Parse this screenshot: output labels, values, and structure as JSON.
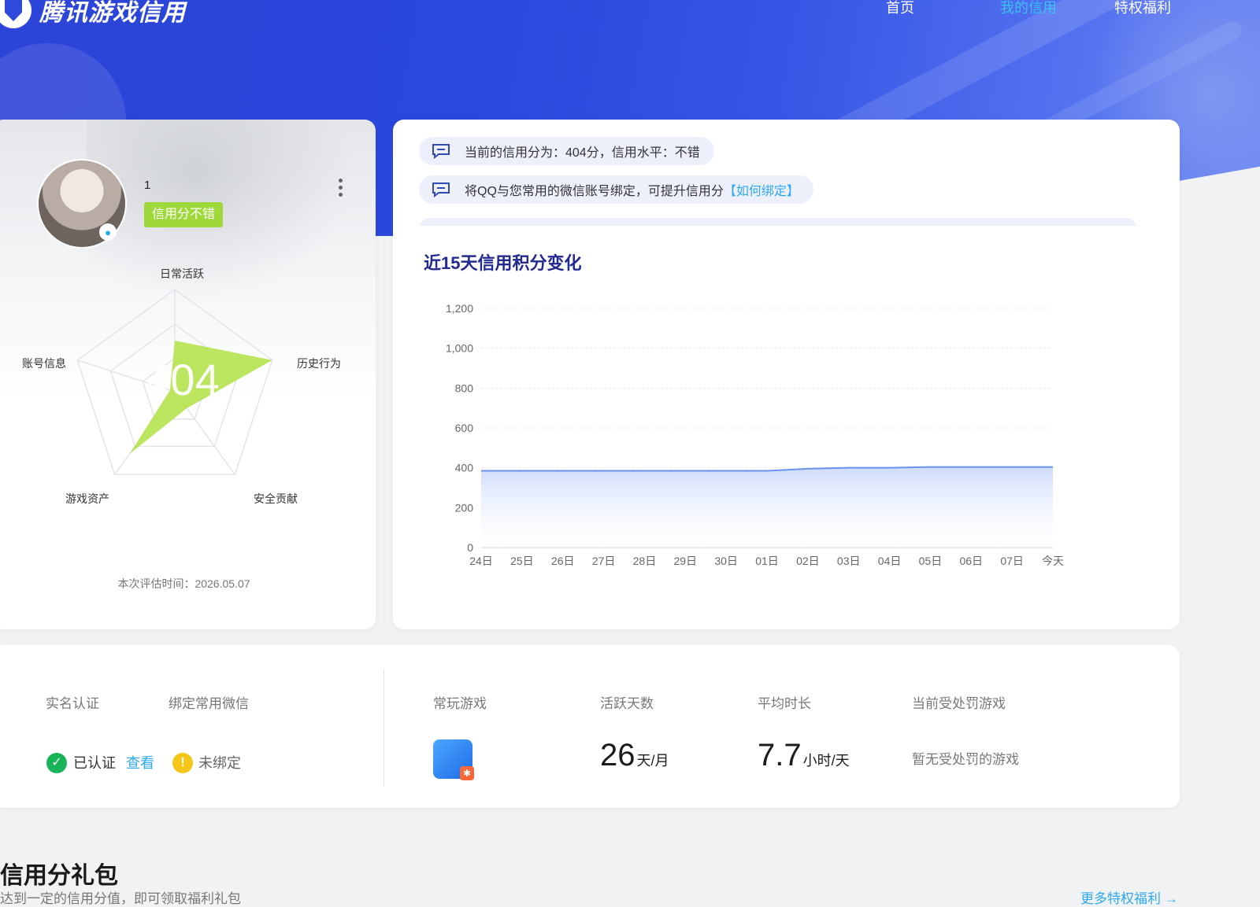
{
  "header": {
    "logo_text": "腾讯游戏信用",
    "nav": [
      "首页",
      "我的信用",
      "特权福利"
    ],
    "nav_active_index": 1
  },
  "profile": {
    "username": "1",
    "level_badge": "信用分不错",
    "score": "404",
    "radar_labels": [
      "日常活跃",
      "历史行为",
      "安全贡献",
      "游戏资产",
      "账号信息"
    ],
    "radar_values": [
      0.5,
      1.0,
      0.2,
      0.75,
      0.05
    ],
    "eval_time": "本次评估时间：2026.05.07"
  },
  "notices": [
    {
      "text": "当前的信用分为：404分，信用水平：不错",
      "link": ""
    },
    {
      "text": "将QQ与您常用的微信账号绑定，可提升信用分",
      "link": "【如何绑定】"
    }
  ],
  "chart": {
    "title": "近15天信用积分变化"
  },
  "chart_data": {
    "type": "area",
    "categories": [
      "24日",
      "25日",
      "26日",
      "27日",
      "28日",
      "29日",
      "30日",
      "01日",
      "02日",
      "03日",
      "04日",
      "05日",
      "06日",
      "07日",
      "今天"
    ],
    "values": [
      385,
      385,
      385,
      385,
      385,
      385,
      385,
      385,
      395,
      400,
      400,
      404,
      404,
      404,
      404
    ],
    "ylim": [
      0,
      1200
    ],
    "yticks": [
      0,
      200,
      400,
      600,
      800,
      1000,
      1200
    ],
    "ytick_labels": [
      "0",
      "200",
      "400",
      "600",
      "800",
      "1,000",
      "1,200"
    ],
    "grid": true,
    "colors": {
      "line": "#6a93ef",
      "fill": "#dbe5fd"
    }
  },
  "stats": {
    "realname_label": "实名认证",
    "wechat_label": "绑定常用微信",
    "realname_status": "已认证",
    "view_link": "查看",
    "wechat_status": "未绑定",
    "games_label": "常玩游戏",
    "active_label": "活跃天数",
    "active_value": "26",
    "active_unit": "天/月",
    "avg_label": "平均时长",
    "avg_value": "7.7",
    "avg_unit": "小时/天",
    "penalty_label": "当前受处罚游戏",
    "penalty_value": "暂无受处罚的游戏"
  },
  "gift": {
    "title": "信用分礼包",
    "subtitle": "达到一定的信用分值，即可领取福利礼包",
    "more_link": "更多特权福利 →"
  }
}
